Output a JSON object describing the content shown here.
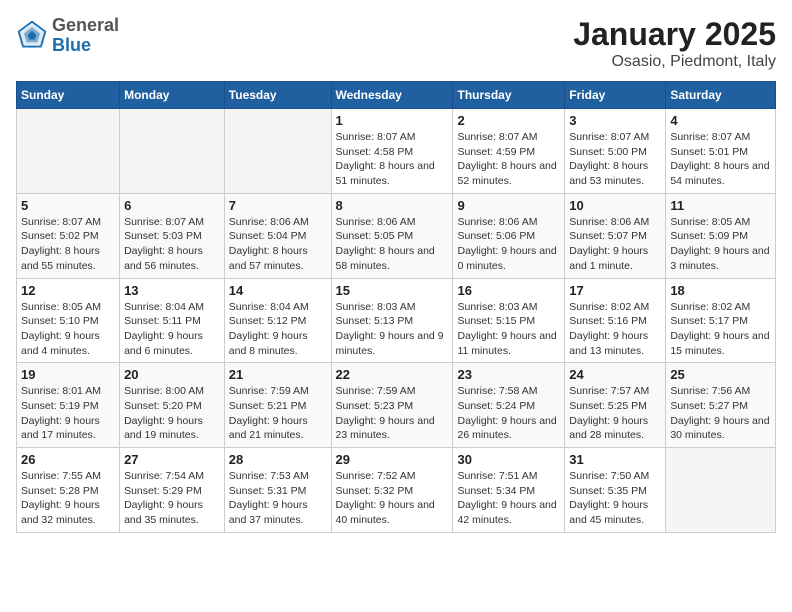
{
  "header": {
    "logo_general": "General",
    "logo_blue": "Blue",
    "title": "January 2025",
    "subtitle": "Osasio, Piedmont, Italy"
  },
  "days_of_week": [
    "Sunday",
    "Monday",
    "Tuesday",
    "Wednesday",
    "Thursday",
    "Friday",
    "Saturday"
  ],
  "weeks": [
    [
      {
        "day": "",
        "info": ""
      },
      {
        "day": "",
        "info": ""
      },
      {
        "day": "",
        "info": ""
      },
      {
        "day": "1",
        "info": "Sunrise: 8:07 AM\nSunset: 4:58 PM\nDaylight: 8 hours\nand 51 minutes."
      },
      {
        "day": "2",
        "info": "Sunrise: 8:07 AM\nSunset: 4:59 PM\nDaylight: 8 hours\nand 52 minutes."
      },
      {
        "day": "3",
        "info": "Sunrise: 8:07 AM\nSunset: 5:00 PM\nDaylight: 8 hours\nand 53 minutes."
      },
      {
        "day": "4",
        "info": "Sunrise: 8:07 AM\nSunset: 5:01 PM\nDaylight: 8 hours\nand 54 minutes."
      }
    ],
    [
      {
        "day": "5",
        "info": "Sunrise: 8:07 AM\nSunset: 5:02 PM\nDaylight: 8 hours\nand 55 minutes."
      },
      {
        "day": "6",
        "info": "Sunrise: 8:07 AM\nSunset: 5:03 PM\nDaylight: 8 hours\nand 56 minutes."
      },
      {
        "day": "7",
        "info": "Sunrise: 8:06 AM\nSunset: 5:04 PM\nDaylight: 8 hours\nand 57 minutes."
      },
      {
        "day": "8",
        "info": "Sunrise: 8:06 AM\nSunset: 5:05 PM\nDaylight: 8 hours\nand 58 minutes."
      },
      {
        "day": "9",
        "info": "Sunrise: 8:06 AM\nSunset: 5:06 PM\nDaylight: 9 hours\nand 0 minutes."
      },
      {
        "day": "10",
        "info": "Sunrise: 8:06 AM\nSunset: 5:07 PM\nDaylight: 9 hours\nand 1 minute."
      },
      {
        "day": "11",
        "info": "Sunrise: 8:05 AM\nSunset: 5:09 PM\nDaylight: 9 hours\nand 3 minutes."
      }
    ],
    [
      {
        "day": "12",
        "info": "Sunrise: 8:05 AM\nSunset: 5:10 PM\nDaylight: 9 hours\nand 4 minutes."
      },
      {
        "day": "13",
        "info": "Sunrise: 8:04 AM\nSunset: 5:11 PM\nDaylight: 9 hours\nand 6 minutes."
      },
      {
        "day": "14",
        "info": "Sunrise: 8:04 AM\nSunset: 5:12 PM\nDaylight: 9 hours\nand 8 minutes."
      },
      {
        "day": "15",
        "info": "Sunrise: 8:03 AM\nSunset: 5:13 PM\nDaylight: 9 hours\nand 9 minutes."
      },
      {
        "day": "16",
        "info": "Sunrise: 8:03 AM\nSunset: 5:15 PM\nDaylight: 9 hours\nand 11 minutes."
      },
      {
        "day": "17",
        "info": "Sunrise: 8:02 AM\nSunset: 5:16 PM\nDaylight: 9 hours\nand 13 minutes."
      },
      {
        "day": "18",
        "info": "Sunrise: 8:02 AM\nSunset: 5:17 PM\nDaylight: 9 hours\nand 15 minutes."
      }
    ],
    [
      {
        "day": "19",
        "info": "Sunrise: 8:01 AM\nSunset: 5:19 PM\nDaylight: 9 hours\nand 17 minutes."
      },
      {
        "day": "20",
        "info": "Sunrise: 8:00 AM\nSunset: 5:20 PM\nDaylight: 9 hours\nand 19 minutes."
      },
      {
        "day": "21",
        "info": "Sunrise: 7:59 AM\nSunset: 5:21 PM\nDaylight: 9 hours\nand 21 minutes."
      },
      {
        "day": "22",
        "info": "Sunrise: 7:59 AM\nSunset: 5:23 PM\nDaylight: 9 hours\nand 23 minutes."
      },
      {
        "day": "23",
        "info": "Sunrise: 7:58 AM\nSunset: 5:24 PM\nDaylight: 9 hours\nand 26 minutes."
      },
      {
        "day": "24",
        "info": "Sunrise: 7:57 AM\nSunset: 5:25 PM\nDaylight: 9 hours\nand 28 minutes."
      },
      {
        "day": "25",
        "info": "Sunrise: 7:56 AM\nSunset: 5:27 PM\nDaylight: 9 hours\nand 30 minutes."
      }
    ],
    [
      {
        "day": "26",
        "info": "Sunrise: 7:55 AM\nSunset: 5:28 PM\nDaylight: 9 hours\nand 32 minutes."
      },
      {
        "day": "27",
        "info": "Sunrise: 7:54 AM\nSunset: 5:29 PM\nDaylight: 9 hours\nand 35 minutes."
      },
      {
        "day": "28",
        "info": "Sunrise: 7:53 AM\nSunset: 5:31 PM\nDaylight: 9 hours\nand 37 minutes."
      },
      {
        "day": "29",
        "info": "Sunrise: 7:52 AM\nSunset: 5:32 PM\nDaylight: 9 hours\nand 40 minutes."
      },
      {
        "day": "30",
        "info": "Sunrise: 7:51 AM\nSunset: 5:34 PM\nDaylight: 9 hours\nand 42 minutes."
      },
      {
        "day": "31",
        "info": "Sunrise: 7:50 AM\nSunset: 5:35 PM\nDaylight: 9 hours\nand 45 minutes."
      },
      {
        "day": "",
        "info": ""
      }
    ]
  ]
}
